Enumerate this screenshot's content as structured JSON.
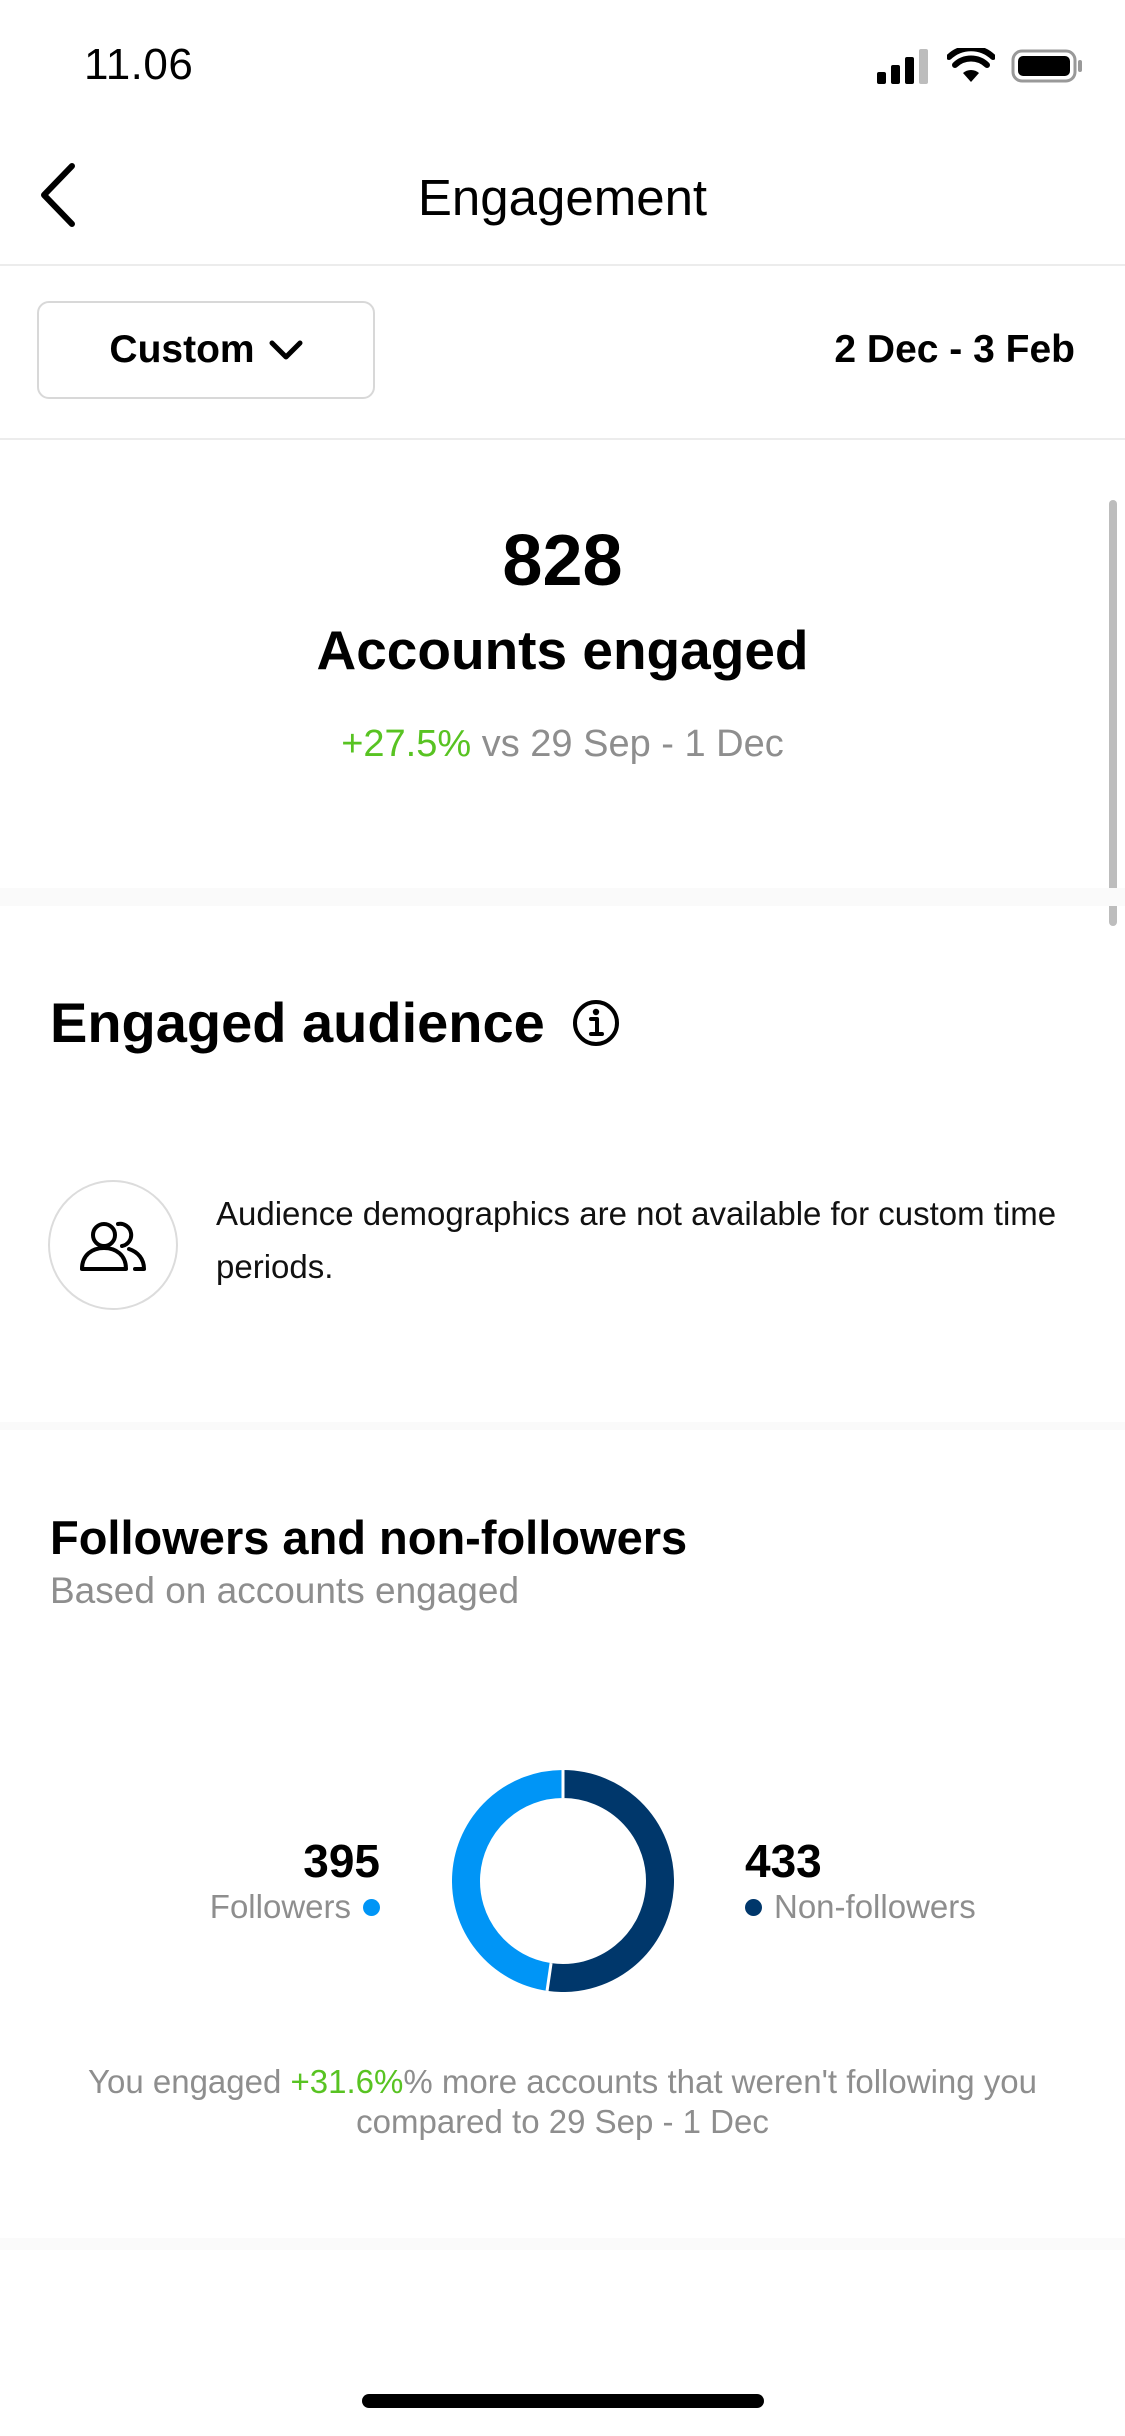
{
  "status_bar": {
    "time": "11.06"
  },
  "header": {
    "title": "Engagement"
  },
  "filter": {
    "range_label": "Custom",
    "dates": "2 Dec - 3 Feb"
  },
  "summary": {
    "value": "828",
    "label": "Accounts engaged",
    "change": "+27.5%",
    "compare_text": " vs 29 Sep - 1 Dec"
  },
  "engaged_audience": {
    "title": "Engaged audience",
    "message": "Audience demographics are not available for custom time periods."
  },
  "followers_section": {
    "title": "Followers and non-followers",
    "subtitle": "Based on accounts engaged",
    "followers_value": "395",
    "followers_label": "Followers",
    "non_followers_value": "433",
    "non_followers_label": "Non-followers",
    "footnote_prefix": "You engaged ",
    "footnote_change": "+31.6%",
    "footnote_line1_suffix": "% more accounts that weren't following you",
    "footnote_line2": "compared to 29 Sep - 1 Dec",
    "colors": {
      "followers": "#0095f6",
      "non_followers": "#00376b"
    }
  },
  "chart_data": {
    "type": "pie",
    "categories": [
      "Followers",
      "Non-followers"
    ],
    "values": [
      395,
      433
    ]
  }
}
